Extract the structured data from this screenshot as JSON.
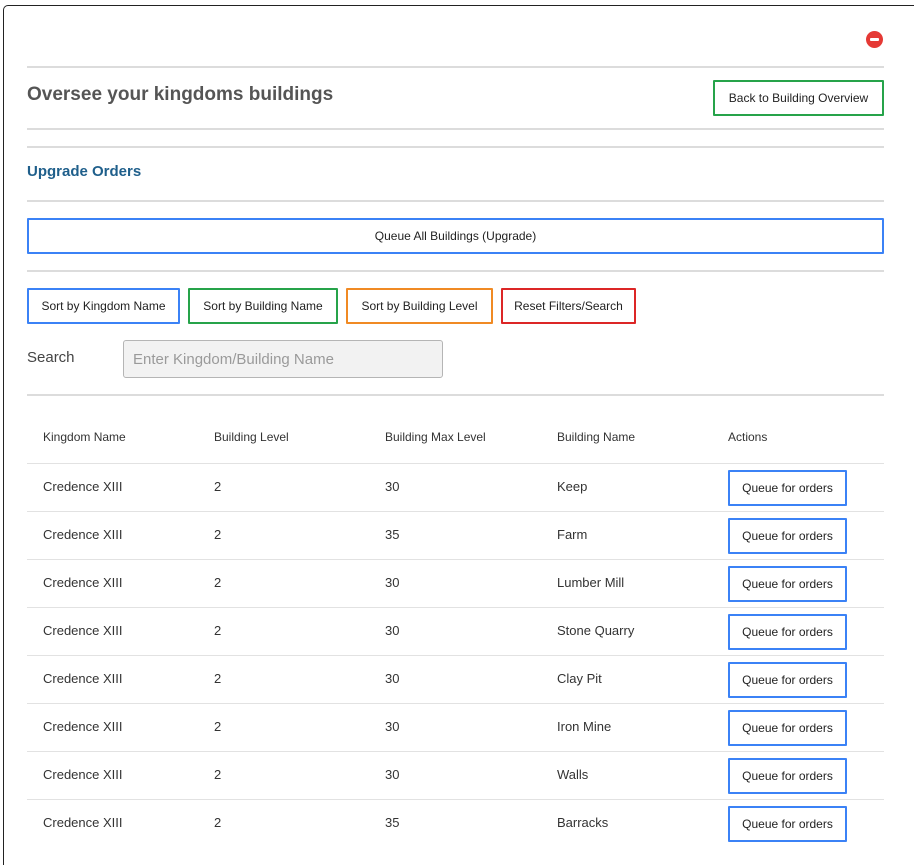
{
  "header": {
    "title": "Oversee your kingdoms buildings",
    "back_button": "Back to Building Overview",
    "close_icon": "minus-circle-icon"
  },
  "section": {
    "title": "Upgrade Orders",
    "queue_all_button": "Queue All Buildings (Upgrade)"
  },
  "filters": {
    "sort_kingdom": "Sort by Kingdom Name",
    "sort_building": "Sort by Building Name",
    "sort_level": "Sort by Building Level",
    "reset": "Reset Filters/Search"
  },
  "search": {
    "label": "Search",
    "placeholder": "Enter Kingdom/Building Name"
  },
  "table": {
    "headers": [
      "Kingdom Name",
      "Building Level",
      "Building Max Level",
      "Building Name",
      "Actions"
    ],
    "action_label": "Queue for orders",
    "rows": [
      {
        "kingdom": "Credence XIII",
        "level": "2",
        "max_level": "30",
        "building": "Keep"
      },
      {
        "kingdom": "Credence XIII",
        "level": "2",
        "max_level": "35",
        "building": "Farm"
      },
      {
        "kingdom": "Credence XIII",
        "level": "2",
        "max_level": "30",
        "building": "Lumber Mill"
      },
      {
        "kingdom": "Credence XIII",
        "level": "2",
        "max_level": "30",
        "building": "Stone Quarry"
      },
      {
        "kingdom": "Credence XIII",
        "level": "2",
        "max_level": "30",
        "building": "Clay Pit"
      },
      {
        "kingdom": "Credence XIII",
        "level": "2",
        "max_level": "30",
        "building": "Iron Mine"
      },
      {
        "kingdom": "Credence XIII",
        "level": "2",
        "max_level": "30",
        "building": "Walls"
      },
      {
        "kingdom": "Credence XIII",
        "level": "2",
        "max_level": "35",
        "building": "Barracks"
      }
    ]
  },
  "colors": {
    "title_blue": "#1f5f8b",
    "green": "#26a34a",
    "blue": "#3b82f6",
    "orange": "#f08a24",
    "red": "#dc2626"
  }
}
